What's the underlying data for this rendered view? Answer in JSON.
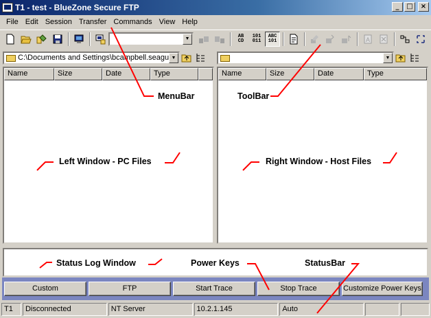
{
  "window": {
    "title": "T1 - test - BlueZone Secure FTP",
    "minimize": "_",
    "maximize": "□",
    "close": "×"
  },
  "menubar": {
    "items": [
      "File",
      "Edit",
      "Session",
      "Transfer",
      "Commands",
      "View",
      "Help"
    ]
  },
  "toolbar": {
    "combo_value": "",
    "icons": [
      "new-icon",
      "open-icon",
      "properties-icon",
      "save-icon",
      "connect-icon",
      "disconnect-icon",
      "upload-icon",
      "download-icon",
      "text-mode-icon",
      "binary-mode-icon",
      "auto-mode-icon",
      "new-folder-icon",
      "rename-icon",
      "delete-icon",
      "chmod-icon",
      "view-icon",
      "print-icon",
      "layout-icon",
      "sync-icon"
    ],
    "mode_labels": {
      "text": "AB\nCD",
      "binary": "101\n011",
      "auto": "ABC\n101"
    }
  },
  "left_pane": {
    "path": "C:\\Documents and Settings\\bcampbell.seagull",
    "columns": [
      "Name",
      "Size",
      "Date",
      "Type"
    ]
  },
  "right_pane": {
    "path": "",
    "columns": [
      "Name",
      "Size",
      "Date",
      "Type"
    ]
  },
  "power_keys": [
    "Custom",
    "FTP",
    "Start Trace",
    "Stop Trace",
    "Customize Power Keys"
  ],
  "statusbar": {
    "fields": [
      "T1",
      "Disconnected",
      "NT Server",
      "10.2.1.145",
      "Auto",
      "",
      ""
    ]
  },
  "annotations": {
    "menubar": "MenuBar",
    "toolbar": "ToolBar",
    "left_window": "Left Window - PC Files",
    "right_window": "Right Window - Host Files",
    "status_log": "Status Log Window",
    "power_keys": "Power Keys",
    "statusbar": "StatusBar"
  },
  "colors": {
    "annotation_line": "#ff0000",
    "title_start": "#0a246a",
    "title_end": "#a6caf0",
    "power_keys_bg": "#7b86c0"
  }
}
